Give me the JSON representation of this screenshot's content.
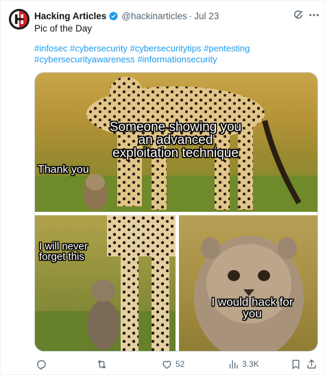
{
  "author": {
    "name": "Hacking Articles",
    "handle": "@hackinarticles",
    "separator": "·",
    "time": "Jul 23",
    "avatar_icon": "hacking-articles-logo",
    "verified_icon": "verified-badge-icon",
    "verified_color": "#1d9bf0"
  },
  "tweet": {
    "text": "Pic of the Day",
    "hashtags": [
      "#infosec",
      "#cybersecurity",
      "#cybersecuritytips",
      "#pentesting",
      "#cybersecurityawareness",
      "#informationsecurity"
    ]
  },
  "meme": {
    "caption_main": "Someone showing you an advanced exploitation technique",
    "caption_thank": "Thank you",
    "caption_never": "I will never forget this",
    "caption_hack": "I would hack for you"
  },
  "actions": {
    "reply_icon": "reply-icon",
    "retweet_icon": "retweet-icon",
    "like_icon": "heart-icon",
    "like_count": "52",
    "views_icon": "views-icon",
    "views_count": "3.3K",
    "bookmark_icon": "bookmark-icon",
    "share_icon": "share-icon"
  },
  "header_icons": [
    "grok-icon",
    "more-icon"
  ],
  "colors": {
    "link": "#1d9bf0",
    "muted": "#536471",
    "text": "#0f1419"
  }
}
